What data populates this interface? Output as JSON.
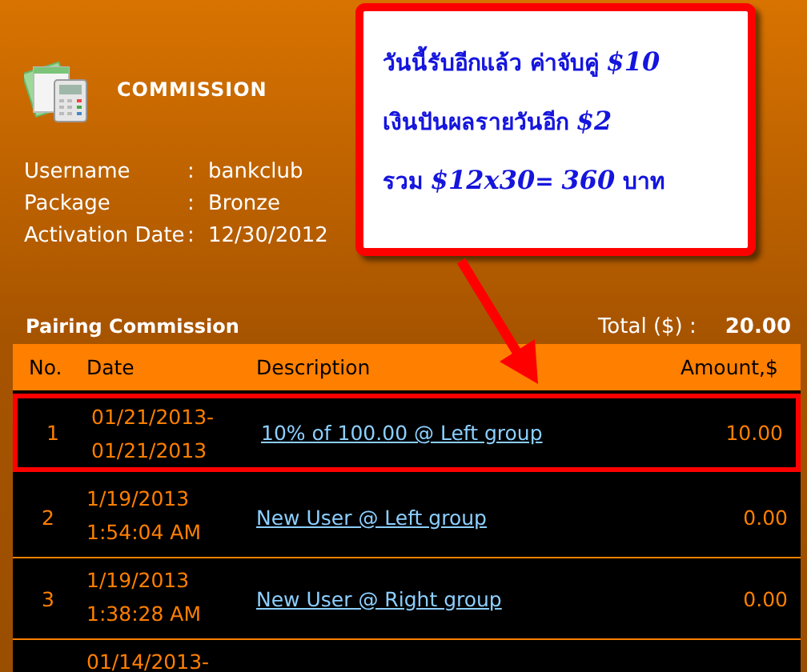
{
  "header": {
    "title": "COMMISSION"
  },
  "info": [
    {
      "label": "Username",
      "separator": ":",
      "value": "bankclub"
    },
    {
      "label": "Package",
      "separator": ":",
      "value": "Bronze"
    },
    {
      "label": "Activation Date",
      "separator": ":",
      "value": "12/30/2012"
    }
  ],
  "callout": {
    "lines": [
      "วันนี้รับอีกแล้ว ค่าจับคู่ **$10**",
      "เงินปันผลรายวันอีก **$2**",
      "รวม **$12x30**= **360** บาท"
    ]
  },
  "section": {
    "title": "Pairing Commission",
    "total_label": "Total ($) :",
    "total_value": "20.00"
  },
  "table": {
    "columns": [
      "No.",
      "Date",
      "Description",
      "Amount,$"
    ],
    "rows": [
      {
        "no": "1",
        "date_lines": [
          "01/21/2013-",
          "01/21/2013"
        ],
        "description": "10% of 100.00 @ Left group",
        "amount": "10.00",
        "selected": true
      },
      {
        "no": "2",
        "date_lines": [
          "1/19/2013",
          "1:54:04 AM"
        ],
        "description": "New User @ Left group",
        "amount": "0.00",
        "selected": false
      },
      {
        "no": "3",
        "date_lines": [
          "1/19/2013",
          "1:38:28 AM"
        ],
        "description": "New User @ Right group",
        "amount": "0.00",
        "selected": false
      },
      {
        "date_lines": [
          "01/14/2013-"
        ],
        "selected": false
      }
    ]
  }
}
